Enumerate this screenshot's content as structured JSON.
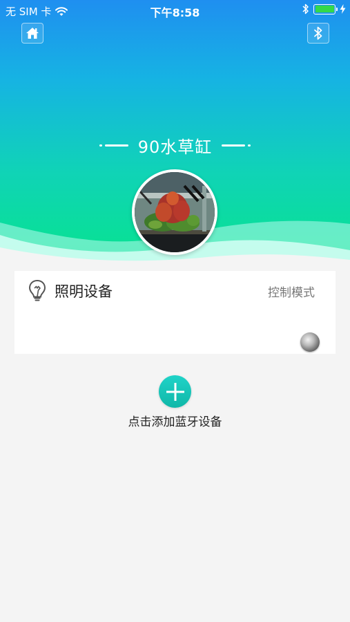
{
  "status_bar": {
    "carrier": "无 SIM 卡",
    "time": "下午8:58",
    "battery_level": 1.0,
    "battery_color": "#34d94a"
  },
  "header": {
    "home_icon": "home-icon",
    "bluetooth_icon": "bluetooth-icon",
    "title": "90水草缸"
  },
  "device_card": {
    "icon": "lightbulb-icon",
    "name": "照明设备",
    "mode_label": "控制模式"
  },
  "add_device": {
    "icon": "plus-icon",
    "label": "点击添加蓝牙设备",
    "color": "#12c4b6"
  },
  "colors": {
    "gradient_top": "#1f8ff0",
    "gradient_bottom": "#07e38f",
    "background": "#f4f4f4"
  }
}
